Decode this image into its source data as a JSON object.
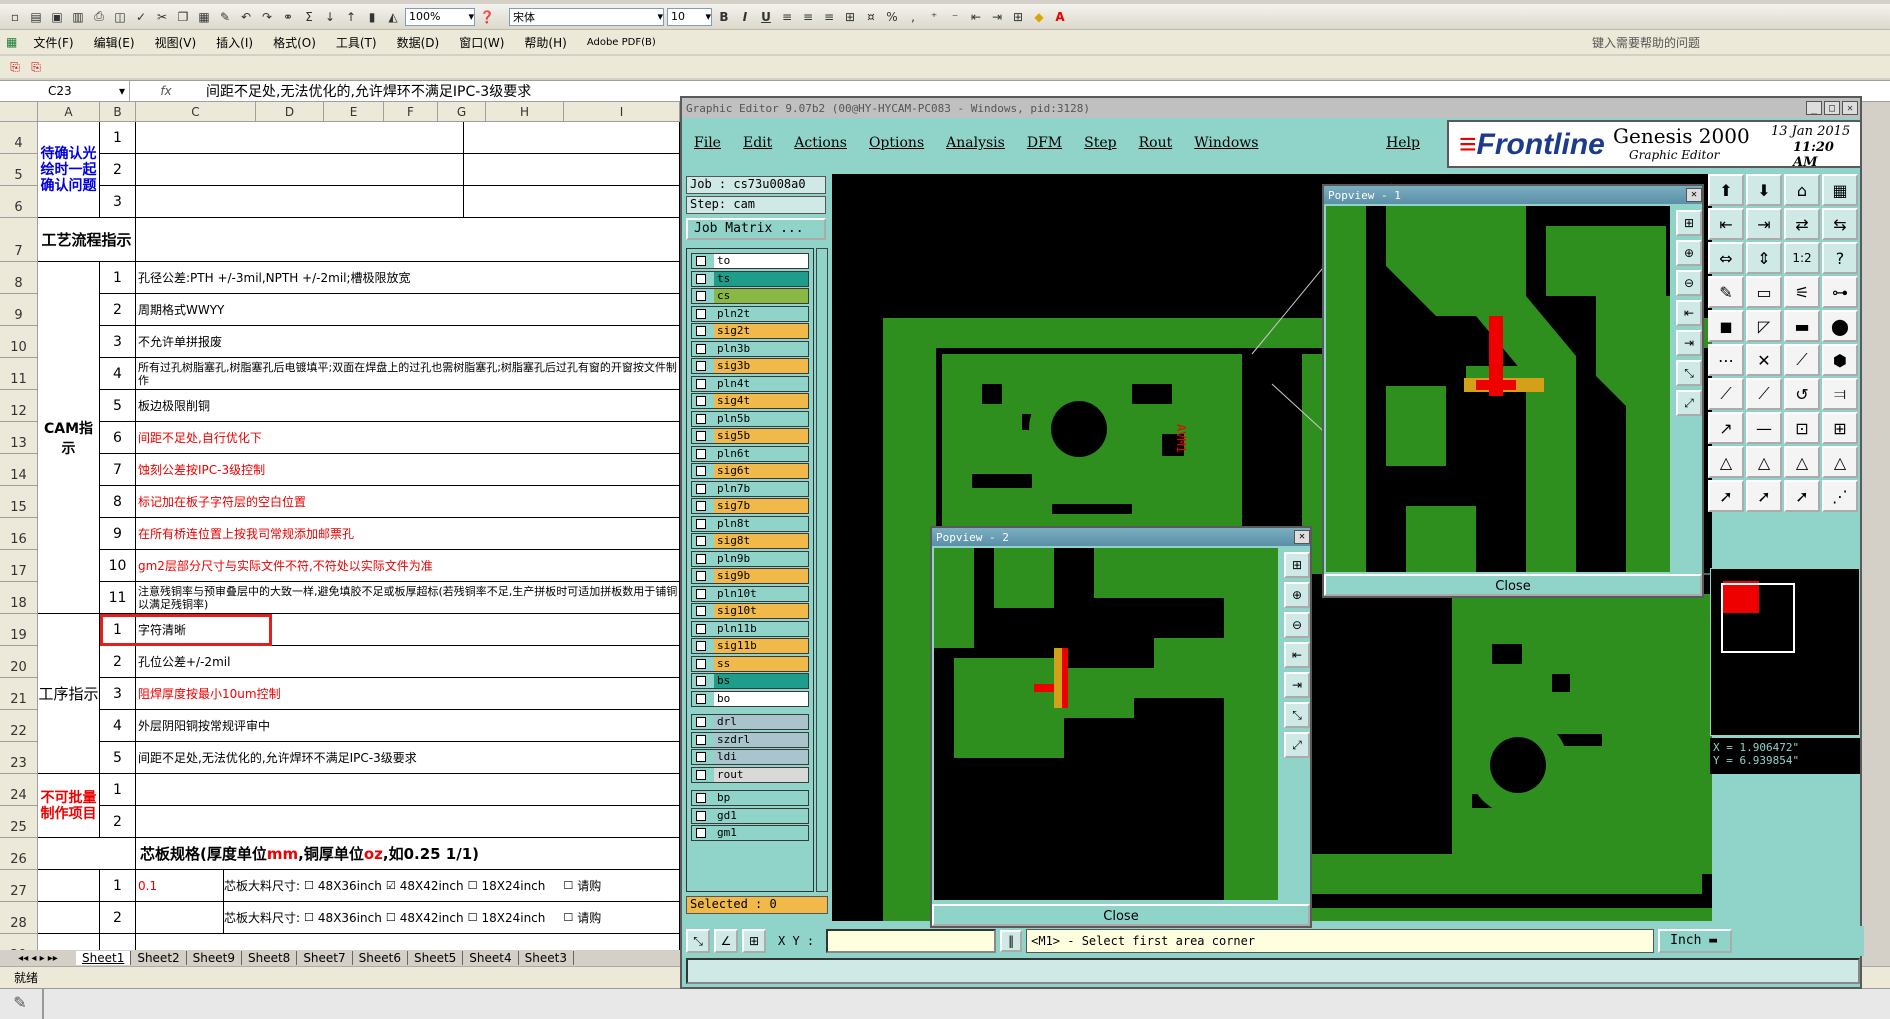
{
  "excel": {
    "font_name": "宋体",
    "font_size": "10",
    "zoom": "100%",
    "help_placeholder": "键入需要帮助的问题",
    "menu": [
      "文件(F)",
      "编辑(E)",
      "视图(V)",
      "插入(I)",
      "格式(O)",
      "工具(T)",
      "数据(D)",
      "窗口(W)",
      "帮助(H)",
      "Adobe PDF(B)"
    ],
    "name_box": "C23",
    "fx": "fx",
    "formula": "间距不足处,无法优化的,允许焊环不满足IPC-3级要求",
    "columns": [
      "A",
      "B",
      "C",
      "D",
      "E",
      "F",
      "G",
      "H",
      "I"
    ],
    "rows": [
      "4",
      "5",
      "6",
      "7",
      "8",
      "9",
      "10",
      "11",
      "12",
      "13",
      "14",
      "15",
      "16",
      "17",
      "18",
      "19",
      "20",
      "21",
      "22",
      "23",
      "24",
      "25",
      "26",
      "27",
      "28",
      "29"
    ],
    "group_a": "待确认光绘时一起确认问题",
    "group_b": "工艺流程指示",
    "group_c": "CAM指示",
    "group_d": "工序指示",
    "group_e": "不可批量制作项目",
    "cam": [
      {
        "n": "1",
        "t": "孔径公差:PTH +/-3mil,NPTH +/-2mil;槽极限放宽",
        "red": false
      },
      {
        "n": "2",
        "t": "周期格式WWYY",
        "red": false
      },
      {
        "n": "3",
        "t": "不允许单拼报废",
        "red": false
      },
      {
        "n": "4",
        "t": "所有过孔树脂塞孔,树脂塞孔后电镀填平;双面在焊盘上的过孔也需树脂塞孔;树脂塞孔后过孔有窗的开窗按文件制作",
        "red": false
      },
      {
        "n": "5",
        "t": "板边极限削铜",
        "red": false
      },
      {
        "n": "6",
        "t": "间距不足处,自行优化下",
        "red": true
      },
      {
        "n": "7",
        "t": "蚀刻公差按IPC-3级控制",
        "red": true
      },
      {
        "n": "8",
        "t": "标记加在板子字符层的空白位置",
        "red": true
      },
      {
        "n": "9",
        "t": "在所有桥连位置上按我司常规添加邮票孔",
        "red": true
      },
      {
        "n": "10",
        "t": "gm2层部分尺寸与实际文件不符,不符处以实际文件为准",
        "red": true
      },
      {
        "n": "11",
        "t": "注意残铜率与预审叠层中的大致一样,避免填胶不足或板厚超标(若残铜率不足,生产拼板时可适加拼板数用于铺铜以满足残铜率)",
        "red": false
      }
    ],
    "proc": [
      {
        "n": "1",
        "t": "字符清晰",
        "red": false
      },
      {
        "n": "2",
        "t": "孔位公差+/-2mil",
        "red": false
      },
      {
        "n": "3",
        "t": "阻焊厚度按最小10um控制",
        "red": true
      },
      {
        "n": "4",
        "t": "外层阴阳铜按常规评审中",
        "red": false
      },
      {
        "n": "5",
        "t": "间距不足处,无法优化的,允许焊环不满足IPC-3级要求",
        "red": false
      }
    ],
    "q_rows": [
      "1",
      "2",
      "3"
    ],
    "bad_rows": [
      "1",
      "2"
    ],
    "core_title_a": "芯板规格(厚度单位",
    "core_title_mm": "mm",
    "core_title_b": ",铜厚单位",
    "core_title_oz": "oz",
    "core_title_c": ",如0.25 1/1)",
    "core_rows": [
      {
        "n": "1",
        "v": "0.1",
        "label": "芯板大料尺寸:",
        "o1": "48X36inch",
        "o2": "48X42inch",
        "o3": "18X24inch",
        "o4": "请购"
      },
      {
        "n": "2",
        "v": "",
        "label": "芯板大料尺寸:",
        "o1": "48X36inch",
        "o2": "48X42inch",
        "o3": "18X24inch",
        "o4": "请购"
      }
    ],
    "sheets": [
      "Sheet1",
      "Sheet2",
      "Sheet9",
      "Sheet8",
      "Sheet7",
      "Sheet6",
      "Sheet5",
      "Sheet4",
      "Sheet3"
    ],
    "status": "就绪"
  },
  "genesis": {
    "title": "Graphic Editor 9.07b2 (00@HY-HYCAM-PC083 - Windows, pid:3128)",
    "menu": [
      "File",
      "Edit",
      "Actions",
      "Options",
      "Analysis",
      "DFM",
      "Step",
      "Rout",
      "Windows"
    ],
    "help": "Help",
    "brand": "Frontline",
    "product": "Genesis 2000",
    "subtitle": "Graphic Editor",
    "date": "13 Jan 2015",
    "time": "11:20 AM",
    "job_label": "Job : cs73u008a0",
    "step_label": "Step: cam",
    "matrix_button": "Job Matrix ...",
    "layers": [
      {
        "n": "to",
        "c": "#ffffff"
      },
      {
        "n": "ts",
        "c": "#1e9e8a"
      },
      {
        "n": "cs",
        "c": "#8ab845"
      },
      {
        "n": "pln2t",
        "c": "#8fd3c9"
      },
      {
        "n": "sig2t",
        "c": "#f0b94a"
      },
      {
        "n": "pln3b",
        "c": "#8fd3c9"
      },
      {
        "n": "sig3b",
        "c": "#f0b94a"
      },
      {
        "n": "pln4t",
        "c": "#8fd3c9"
      },
      {
        "n": "sig4t",
        "c": "#f0b94a"
      },
      {
        "n": "pln5b",
        "c": "#8fd3c9"
      },
      {
        "n": "sig5b",
        "c": "#f0b94a"
      },
      {
        "n": "pln6t",
        "c": "#8fd3c9"
      },
      {
        "n": "sig6t",
        "c": "#f0b94a"
      },
      {
        "n": "pln7b",
        "c": "#8fd3c9"
      },
      {
        "n": "sig7b",
        "c": "#f0b94a"
      },
      {
        "n": "pln8t",
        "c": "#8fd3c9"
      },
      {
        "n": "sig8t",
        "c": "#f0b94a"
      },
      {
        "n": "pln9b",
        "c": "#8fd3c9"
      },
      {
        "n": "sig9b",
        "c": "#f0b94a"
      },
      {
        "n": "pln10t",
        "c": "#8fd3c9"
      },
      {
        "n": "sig10t",
        "c": "#f0b94a"
      },
      {
        "n": "pln11b",
        "c": "#8fd3c9"
      },
      {
        "n": "sig11b",
        "c": "#f0b94a"
      },
      {
        "n": "ss",
        "c": "#f0b94a"
      },
      {
        "n": "bs",
        "c": "#1e9e8a"
      },
      {
        "n": "bo",
        "c": "#ffffff"
      },
      {
        "n": "drl",
        "c": "#a9c4cc"
      },
      {
        "n": "szdrl",
        "c": "#a9c4cc"
      },
      {
        "n": "ldi",
        "c": "#a9c4cc"
      },
      {
        "n": "rout",
        "c": "#d9d9d9"
      },
      {
        "n": "bp",
        "c": "#8fd3c9"
      },
      {
        "n": "gd1",
        "c": "#8fd3c9"
      },
      {
        "n": "gm1",
        "c": "#8fd3c9"
      }
    ],
    "selected": "Selected : 0",
    "popview1": "Popview - 1",
    "popview2": "Popview - 2",
    "close": "Close",
    "xy_label": "X Y :",
    "message": "<M1> - Select first area corner",
    "units": "Inch",
    "x_readout": "X = 1.906472\"",
    "y_readout": "Y = 6.939854\"",
    "board_text": "AVM1"
  }
}
